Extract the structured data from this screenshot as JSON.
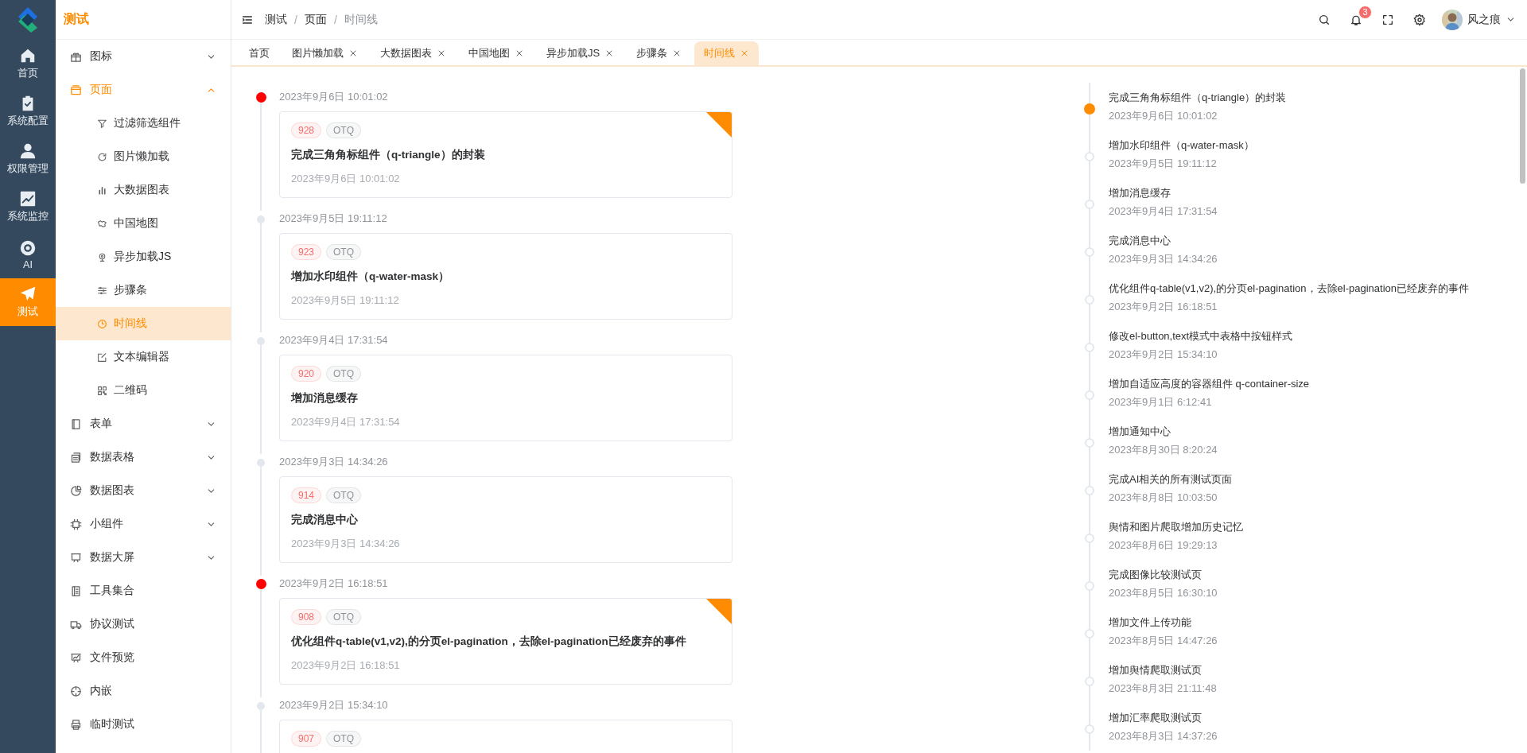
{
  "rail": {
    "items": [
      {
        "label": "首页",
        "selected": false
      },
      {
        "label": "系统配置",
        "selected": false
      },
      {
        "label": "权限管理",
        "selected": false
      },
      {
        "label": "系统监控",
        "selected": false
      },
      {
        "label": "AI",
        "selected": false
      },
      {
        "label": "测试",
        "selected": true
      }
    ]
  },
  "menu": {
    "title": "测试",
    "items": [
      {
        "kind": "group",
        "label": "图标",
        "expanded": false
      },
      {
        "kind": "group",
        "label": "页面",
        "expanded": true,
        "children": [
          {
            "label": "过滤筛选组件",
            "selected": false
          },
          {
            "label": "图片懒加载",
            "selected": false
          },
          {
            "label": "大数据图表",
            "selected": false
          },
          {
            "label": "中国地图",
            "selected": false
          },
          {
            "label": "异步加载JS",
            "selected": false
          },
          {
            "label": "步骤条",
            "selected": false
          },
          {
            "label": "时间线",
            "selected": true
          },
          {
            "label": "文本编辑器",
            "selected": false
          },
          {
            "label": "二维码",
            "selected": false
          }
        ]
      },
      {
        "kind": "group",
        "label": "表单",
        "expanded": false
      },
      {
        "kind": "group",
        "label": "数据表格",
        "expanded": false
      },
      {
        "kind": "group",
        "label": "数据图表",
        "expanded": false
      },
      {
        "kind": "group",
        "label": "小组件",
        "expanded": false
      },
      {
        "kind": "group",
        "label": "数据大屏",
        "expanded": false
      },
      {
        "kind": "link",
        "label": "工具集合"
      },
      {
        "kind": "link",
        "label": "协议测试"
      },
      {
        "kind": "link",
        "label": "文件预览"
      },
      {
        "kind": "link",
        "label": "内嵌"
      },
      {
        "kind": "link",
        "label": "临时测试"
      }
    ]
  },
  "header": {
    "breadcrumb": [
      "测试",
      "页面",
      "时间线"
    ],
    "breadcrumb_separators": [
      "/",
      "/"
    ],
    "notification_count": "3",
    "user": "风之痕"
  },
  "tabs": [
    {
      "label": "首页",
      "closable": false,
      "selected": false
    },
    {
      "label": "图片懒加载",
      "closable": true,
      "selected": false
    },
    {
      "label": "大数据图表",
      "closable": true,
      "selected": false
    },
    {
      "label": "中国地图",
      "closable": true,
      "selected": false
    },
    {
      "label": "异步加载JS",
      "closable": true,
      "selected": false
    },
    {
      "label": "步骤条",
      "closable": true,
      "selected": false
    },
    {
      "label": "时间线",
      "closable": true,
      "selected": true
    }
  ],
  "timeline": [
    {
      "time": "2023年9月6日 10:01:02",
      "highlight": true,
      "tags": [
        {
          "text": "928",
          "color": "#f56c6c"
        },
        {
          "text": "OTQ",
          "color": "#909399"
        }
      ],
      "title": "完成三角角标组件（q-triangle）的封装",
      "date": "2023年9月6日 10:01:02"
    },
    {
      "time": "2023年9月5日 19:11:12",
      "highlight": false,
      "tags": [
        {
          "text": "923",
          "color": "#f56c6c"
        },
        {
          "text": "OTQ",
          "color": "#909399"
        }
      ],
      "title": "增加水印组件（q-water-mask）",
      "date": "2023年9月5日 19:11:12"
    },
    {
      "time": "2023年9月4日 17:31:54",
      "highlight": false,
      "tags": [
        {
          "text": "920",
          "color": "#f56c6c"
        },
        {
          "text": "OTQ",
          "color": "#909399"
        }
      ],
      "title": "增加消息缓存",
      "date": "2023年9月4日 17:31:54"
    },
    {
      "time": "2023年9月3日 14:34:26",
      "highlight": false,
      "tags": [
        {
          "text": "914",
          "color": "#f56c6c"
        },
        {
          "text": "OTQ",
          "color": "#909399"
        }
      ],
      "title": "完成消息中心",
      "date": "2023年9月3日 14:34:26"
    },
    {
      "time": "2023年9月2日 16:18:51",
      "highlight": true,
      "tags": [
        {
          "text": "908",
          "color": "#f56c6c"
        },
        {
          "text": "OTQ",
          "color": "#909399"
        }
      ],
      "title": "优化组件q-table(v1,v2),的分页el-pagination，去除el-pagination已经废弃的事件",
      "date": "2023年9月2日 16:18:51"
    },
    {
      "time": "2023年9月2日 15:34:10",
      "highlight": false,
      "tags": [
        {
          "text": "907",
          "color": "#f56c6c"
        },
        {
          "text": "OTQ",
          "color": "#909399"
        }
      ]
    }
  ],
  "side_timeline": [
    {
      "title": "完成三角角标组件（q-triangle）的封装",
      "time": "2023年9月6日 10:01:02",
      "active": true
    },
    {
      "title": "增加水印组件（q-water-mask）",
      "time": "2023年9月5日 19:11:12",
      "active": false
    },
    {
      "title": "增加消息缓存",
      "time": "2023年9月4日 17:31:54",
      "active": false
    },
    {
      "title": "完成消息中心",
      "time": "2023年9月3日 14:34:26",
      "active": false
    },
    {
      "title": "优化组件q-table(v1,v2),的分页el-pagination，去除el-pagination已经废弃的事件",
      "time": "2023年9月2日 16:18:51",
      "active": false
    },
    {
      "title": "修改el-button,text模式中表格中按钮样式",
      "time": "2023年9月2日 15:34:10",
      "active": false
    },
    {
      "title": "增加自适应高度的容器组件 q-container-size",
      "time": "2023年9月1日 6:12:41",
      "active": false
    },
    {
      "title": "增加通知中心",
      "time": "2023年8月30日 8:20:24",
      "active": false
    },
    {
      "title": "完成AI相关的所有测试页面",
      "time": "2023年8月8日 10:03:50",
      "active": false
    },
    {
      "title": "舆情和图片爬取增加历史记忆",
      "time": "2023年8月6日 19:29:13",
      "active": false
    },
    {
      "title": "完成图像比较测试页",
      "time": "2023年8月5日 16:30:10",
      "active": false
    },
    {
      "title": "增加文件上传功能",
      "time": "2023年8月5日 14:47:26",
      "active": false
    },
    {
      "title": "增加舆情爬取测试页",
      "time": "2023年8月3日 21:11:48",
      "active": false
    },
    {
      "title": "增加汇率爬取测试页",
      "time": "2023年8月3日 14:37:26",
      "active": false
    }
  ]
}
